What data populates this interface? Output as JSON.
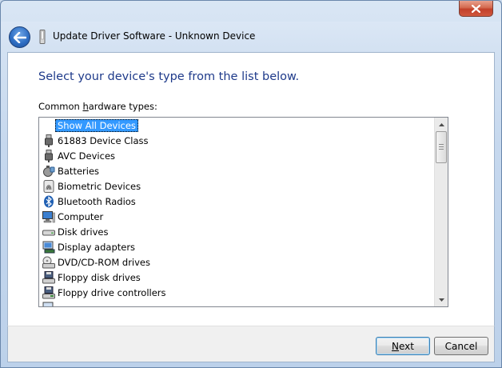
{
  "window": {
    "title": "Update Driver Software - Unknown Device",
    "close_label": "✕"
  },
  "main": {
    "heading": "Select your device's type from the list below.",
    "list_label_prefix": "Common ",
    "list_label_mnemonic": "h",
    "list_label_suffix": "ardware types:"
  },
  "list": {
    "items": [
      {
        "label": "Show All Devices",
        "icon": "none",
        "selected": true
      },
      {
        "label": "61883 Device Class",
        "icon": "usb-plug-icon"
      },
      {
        "label": "AVC Devices",
        "icon": "usb-plug-icon"
      },
      {
        "label": "Batteries",
        "icon": "battery-icon"
      },
      {
        "label": "Biometric Devices",
        "icon": "fingerprint-icon"
      },
      {
        "label": "Bluetooth Radios",
        "icon": "bluetooth-icon"
      },
      {
        "label": "Computer",
        "icon": "computer-icon"
      },
      {
        "label": "Disk drives",
        "icon": "disk-drive-icon"
      },
      {
        "label": "Display adapters",
        "icon": "display-adapter-icon"
      },
      {
        "label": "DVD/CD-ROM drives",
        "icon": "dvd-drive-icon"
      },
      {
        "label": "Floppy disk drives",
        "icon": "floppy-drive-icon"
      },
      {
        "label": "Floppy drive controllers",
        "icon": "floppy-controller-icon"
      }
    ]
  },
  "footer": {
    "next_mnemonic": "N",
    "next_rest": "ext",
    "cancel_label": "Cancel"
  },
  "colors": {
    "heading": "#1e3a8a",
    "selection": "#3399ff",
    "close_button": "#c2402a"
  }
}
